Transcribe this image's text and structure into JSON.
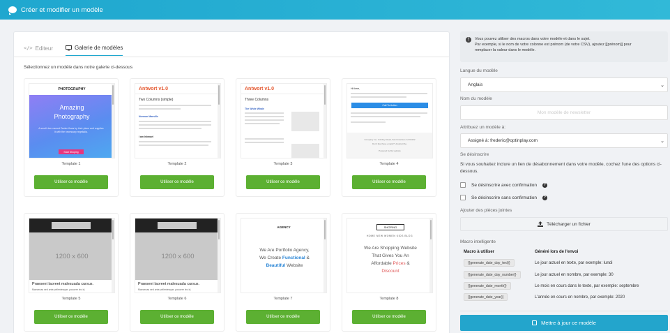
{
  "header": {
    "title": "Créer et modifier un modèle"
  },
  "tabs": [
    {
      "label": "Editeur",
      "icon": "code-icon"
    },
    {
      "label": "Galerie de modèles",
      "icon": "monitor-icon"
    }
  ],
  "gallery": {
    "instruction": "Sélectionnez un modèle dans notre galerie ci-dessous",
    "use_label": "Utiliser ce modèle",
    "templates": [
      {
        "name": "Template 1",
        "header": "PHOTOGRAPHY",
        "title_line1": "Amazing",
        "title_line2": "Photography",
        "body": "A small river named Duden flows by their place and supplies it with the necessary regelialia.",
        "button": "Start Shoping"
      },
      {
        "name": "Template 2",
        "brand": "Antwort v1.0",
        "subtitle": "Two Columns (simple)",
        "author1": "Norman Manville",
        "author2": "I am Ishmael"
      },
      {
        "name": "Template 3",
        "brand": "Antwort v1.0",
        "subtitle": "Three Columns",
        "heading": "The White Whale"
      },
      {
        "name": "Template 4",
        "greeting": "Hi there,",
        "cta": "Call To Action",
        "footer_company": "Company Inc, 3 Abbey Road, San Francisco CA 94102",
        "footer_unsub": "Don't like these emails? Unsubscribe.",
        "footer_powered": "Powered by My website"
      },
      {
        "name": "Template 5",
        "image_label": "1200 x 600",
        "caption": "Praesent laoreet malesuada cursus.",
        "subcaption": "Maecenas sed ante pellentesque, posuere leo id,"
      },
      {
        "name": "Template 6",
        "image_label": "1200 x 600",
        "caption": "Praesent laoreet malesuada cursus.",
        "subcaption": "Maecenas sed ante pellentesque, posuere leo id,"
      },
      {
        "name": "Template 7",
        "header": "AGENCY",
        "line1": "We Are Portfolio Agency,",
        "line2_a": "We Create ",
        "line2_b": "Functional",
        "line2_c": " &",
        "line3_a": "Beautiful",
        "line3_b": " Website"
      },
      {
        "name": "Template 8",
        "logo": "SHOPING",
        "nav": "HOME  NEW  WOMEN  KIDS  BLOG",
        "line1": "We Are Shopping Website",
        "line2": "That Gives You An",
        "line3_a": "Affordable ",
        "line3_b": "Prices",
        "line3_c": " &",
        "line4": "Discount"
      }
    ]
  },
  "sidebar": {
    "info_line1": "Vous pouvez utiliser des macros dans votre modèle et dans le sujet.",
    "info_line2": "Par exemple, si le nom de votre colonne est prénom (de votre CSV), ajoutez [[prénom]] pour",
    "info_line3": "remplacer la valeur dans le modèle.",
    "language_label": "Langue du modèle",
    "language_value": "Anglais",
    "name_label": "Nom du modèle",
    "name_placeholder": "Mon modèle de newsletter",
    "assign_label": "Attribuez un modèle à:",
    "assign_value": "Assigné à: frederic@optinplay.com",
    "unsub_label": "Se désinscrire",
    "unsub_desc": "Si vous souhaitez inclure un lien de désabonnement dans votre modèle, cochez l'une des options ci-dessous.",
    "unsub_opt1": "Se désinscrire avec confirmation",
    "unsub_opt2": "Se désinscrire sans confirmation",
    "attach_label": "Ajouter des pièces jointes",
    "upload_label": "Télécharger un fichier",
    "macro_label": "Macro intelligente",
    "macro_col1": "Macro à utiliser",
    "macro_col2": "Généré lors de l'envoi",
    "macros": [
      {
        "code": "{{generate_date_day_text}}",
        "desc": "Le jour actuel en texte, par exemple: lundi"
      },
      {
        "code": "{{generate_date_day_number}}",
        "desc": "Le jour actuel en nombre, par exemple: 30"
      },
      {
        "code": "{{generate_date_month}}",
        "desc": "Le mois en cours dans le texte, par exemple: septembre"
      },
      {
        "code": "{{generate_date_year}}",
        "desc": "L'année en cours en nombre, par exemple: 2020"
      }
    ],
    "save_label": "Mettre à jour ce modèle"
  }
}
